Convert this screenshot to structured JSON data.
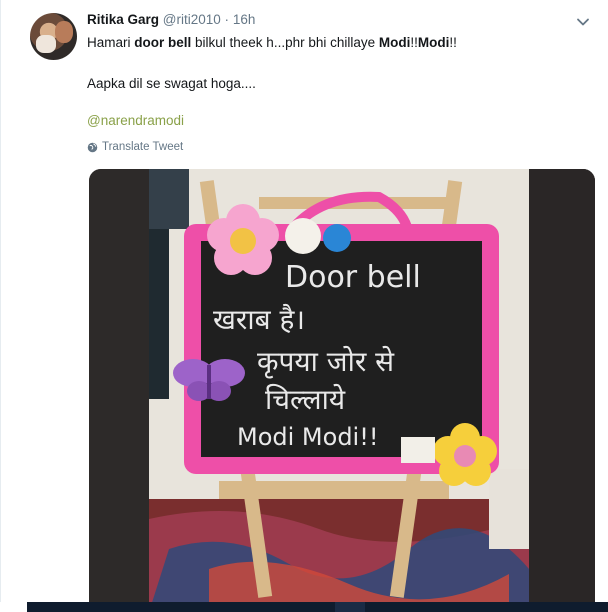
{
  "tweet": {
    "display_name": "Ritika Garg",
    "handle": "@riti2010",
    "separator": "·",
    "timestamp": "16h",
    "line1_parts": [
      "Hamari ",
      "door bell",
      " bilkul theek h...phr bhi chillaye ",
      "Modi",
      "!!",
      "Modi",
      "!!"
    ],
    "line2": "Aapka dil se swagat hoga....",
    "mention": "@narendramodi",
    "translate_label": "Translate Tweet",
    "icons": {
      "more": "chevron-down-icon",
      "translate": "globe-icon"
    }
  },
  "photo": {
    "board_lines": [
      "Door bell",
      "खराब है।",
      "कृपया जोर से",
      "चिल्लाये",
      "Modi Modi!!"
    ]
  },
  "colors": {
    "link": "#8aa149",
    "muted": "#657786",
    "board_frame": "#ee4fa8"
  }
}
